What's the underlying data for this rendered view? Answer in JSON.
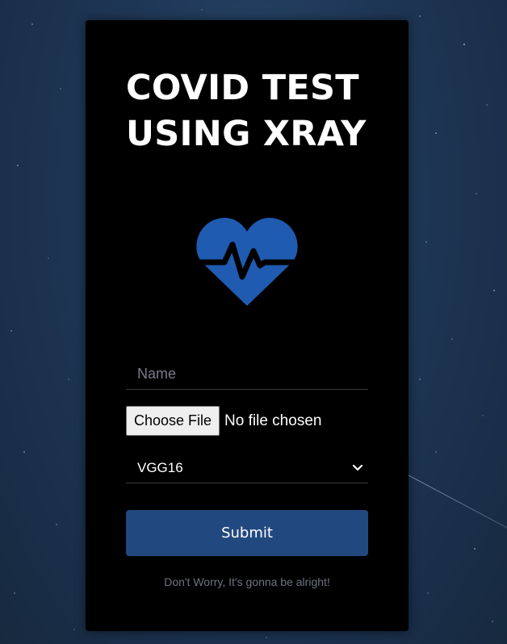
{
  "app": {
    "title": "COVID TEST USING XRAY",
    "title_lines": [
      "COVID TEST",
      "USING XRAY"
    ]
  },
  "form": {
    "name_placeholder": "Name",
    "name_value": "",
    "file_button_label": "Choose File",
    "file_status": "No file chosen",
    "model_selected": "VGG16",
    "submit_label": "Submit"
  },
  "footer": {
    "note": "Don't Worry, It's gonna be alright!"
  },
  "icons": {
    "logo": "heart-pulse-icon",
    "dropdown": "chevron-down-icon"
  },
  "colors": {
    "accent": "#22497f",
    "heart": "#1f5bb0",
    "card_background": "#000000"
  }
}
